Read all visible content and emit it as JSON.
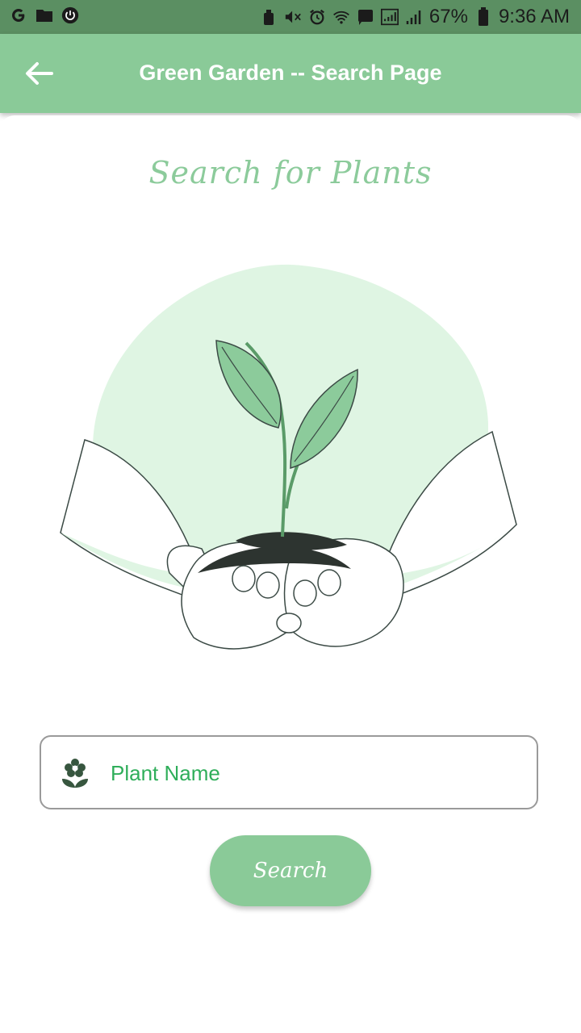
{
  "status_bar": {
    "battery_percent": "67%",
    "time": "9:36 AM",
    "left_icons": [
      "google-icon",
      "folder-icon",
      "power-icon"
    ],
    "right_icons": [
      "lock-icon",
      "mute-icon",
      "alarm-icon",
      "wifi-icon",
      "signal-icon"
    ]
  },
  "app_bar": {
    "title": "Green Garden -- Search Page",
    "back_icon": "arrow-left-icon"
  },
  "main": {
    "heading": "Search for Plants",
    "illustration": "hands-holding-seedling",
    "search_field": {
      "icon": "flower-icon",
      "placeholder": "Plant Name",
      "value": ""
    },
    "search_button_label": "Search"
  },
  "colors": {
    "status_bar": "#5b8f62",
    "app_bar": "#8aca98",
    "accent_green": "#2fae5a",
    "heading_green": "#8ccb9b",
    "blob": "#dff5e3"
  }
}
